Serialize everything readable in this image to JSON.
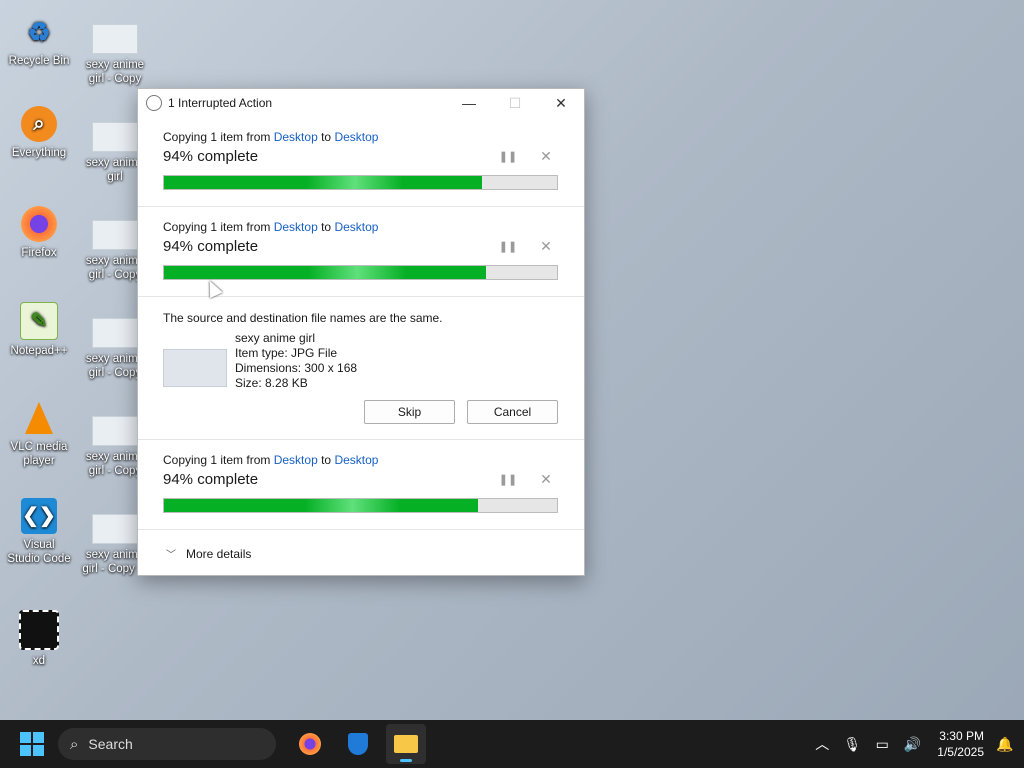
{
  "desktop": {
    "icons": [
      {
        "label": "Recycle Bin"
      },
      {
        "label": "Everything"
      },
      {
        "label": "Firefox"
      },
      {
        "label": "Notepad++"
      },
      {
        "label": "VLC media player"
      },
      {
        "label": "Visual Studio Code"
      },
      {
        "label": "xd"
      }
    ],
    "files": [
      {
        "label": "sexy anime girl - Copy"
      },
      {
        "label": "sexy anime girl"
      },
      {
        "label": "sexy anime girl - Copy"
      },
      {
        "label": "sexy anime girl - Copy"
      },
      {
        "label": "sexy anime girl - Copy"
      },
      {
        "label": "sexy anime girl - Copy ..."
      }
    ]
  },
  "dialog": {
    "title": "1 Interrupted Action",
    "operations": [
      {
        "prefix": "Copying 1 item from",
        "from": "Desktop",
        "to_word": "to",
        "to": "Desktop",
        "status": "94% complete",
        "progress": 0.81
      },
      {
        "prefix": "Copying 1 item from",
        "from": "Desktop",
        "to_word": "to",
        "to": "Desktop",
        "status": "94% complete",
        "progress": 0.82
      },
      {
        "prefix": "Copying 1 item from",
        "from": "Desktop",
        "to_word": "to",
        "to": "Desktop",
        "status": "94% complete",
        "progress": 0.8
      }
    ],
    "conflict": {
      "message": "The source and destination file names are the same.",
      "file_name": "sexy anime girl",
      "item_type": "Item type: JPG File",
      "dimensions": "Dimensions: 300 x 168",
      "size": "Size: 8.28 KB",
      "skip_label": "Skip",
      "cancel_label": "Cancel"
    },
    "more_details": "More details"
  },
  "taskbar": {
    "search_label": "Search",
    "time": "3:30 PM",
    "date": "1/5/2025"
  }
}
